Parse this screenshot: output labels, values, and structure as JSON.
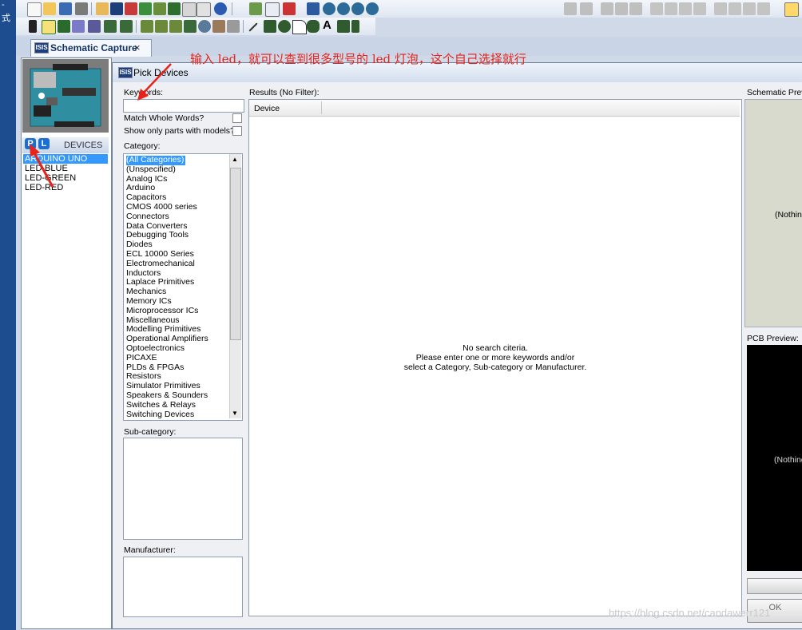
{
  "desktop": {
    "chars": [
      "-",
      "式"
    ]
  },
  "tab": {
    "label": "Schematic Capture",
    "close": "×"
  },
  "left_panel": {
    "mode_p": "P",
    "mode_l": "L",
    "devices_header": "DEVICES",
    "devices": [
      "ARDUINO UNO",
      "LED-BLUE",
      "LED-GREEN",
      "LED-RED"
    ]
  },
  "dialog": {
    "icon_text": "ISIS",
    "title": "Pick Devices",
    "keywords_label": "Keywords:",
    "keywords_value": "",
    "match_whole_words": "Match Whole Words?",
    "show_only_models": "Show only parts with models?",
    "category_label": "Category:",
    "categories": [
      "(All Categories)",
      "(Unspecified)",
      "Analog ICs",
      "Arduino",
      "Capacitors",
      "CMOS 4000 series",
      "Connectors",
      "Data Converters",
      "Debugging Tools",
      "Diodes",
      "ECL 10000 Series",
      "Electromechanical",
      "Inductors",
      "Laplace Primitives",
      "Mechanics",
      "Memory ICs",
      "Microprocessor ICs",
      "Miscellaneous",
      "Modelling Primitives",
      "Operational Amplifiers",
      "Optoelectronics",
      "PICAXE",
      "PLDs & FPGAs",
      "Resistors",
      "Simulator Primitives",
      "Speakers & Sounders",
      "Switches & Relays",
      "Switching Devices"
    ],
    "subcategory_label": "Sub-category:",
    "manufacturer_label": "Manufacturer:",
    "results_label": "Results (No Filter):",
    "device_col": "Device",
    "no_search_1": "No search citeria.",
    "no_search_2": "Please enter one or more keywords and/or",
    "no_search_3": "select a Category, Sub-category or Manufacturer.",
    "schematic_preview_label": "Schematic Prev",
    "schematic_preview_text": "(Nothing",
    "pcb_preview_label": "PCB Preview:",
    "pcb_preview_text": "(Nothing",
    "ok_label": "OK"
  },
  "annotation": "输入 led，就可以查到很多型号的 led 灯泡，这个自己选择就行",
  "watermark": "https://blog.csdn.net/candawerr121",
  "colors": {
    "accent": "#3399ff",
    "annotation": "#e8231a",
    "arrow": "#e8231a"
  }
}
